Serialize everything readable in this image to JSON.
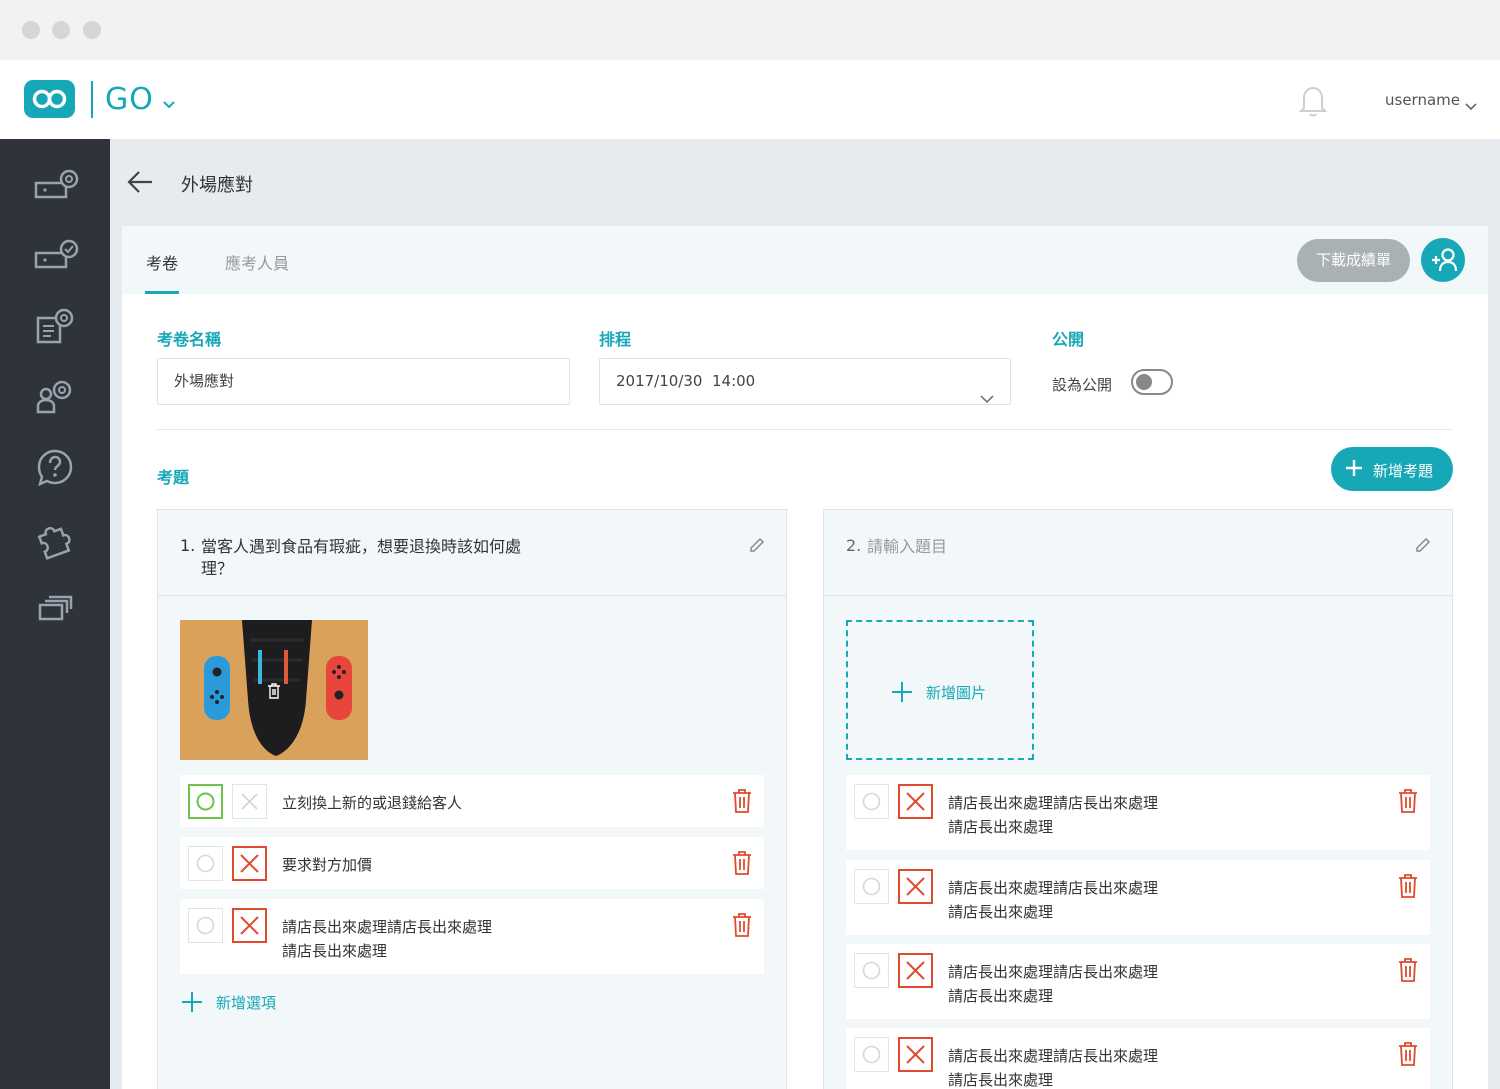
{
  "header": {
    "app_name": "GO",
    "username": "username"
  },
  "page": {
    "title": "外場應對"
  },
  "tabs": [
    {
      "label": "考卷"
    },
    {
      "label": "應考人員"
    }
  ],
  "actions": {
    "download_label": "下載成績單"
  },
  "form": {
    "name_label": "考卷名稱",
    "name_value": "外場應對",
    "schedule_label": "排程",
    "schedule_value": "2017/10/30  14:00",
    "public_label": "公開",
    "public_toggle_label": "設為公開",
    "public_on": false
  },
  "questions_section": {
    "label": "考題",
    "add_button_label": "新增考題"
  },
  "questions": [
    {
      "number": "1.",
      "text": "當客人遇到食品有瑕疵，想要退換時該如何處理？",
      "options": [
        {
          "text": "立刻換上新的或退錢給客人",
          "correct": true
        },
        {
          "text": "要求對方加價",
          "correct": false
        },
        {
          "text": "請店長出來處理請店長出來處理請店長出來處理",
          "correct": false
        }
      ],
      "add_option_label": "新增選項"
    },
    {
      "number": "2.",
      "text": "請輸入題目",
      "add_image_label": "新增圖片",
      "options": [
        {
          "text": "請店長出來處理請店長出來處理請店長出來處理",
          "correct": false
        },
        {
          "text": "請店長出來處理請店長出來處理請店長出來處理",
          "correct": false
        },
        {
          "text": "請店長出來處理請店長出來處理請店長出來處理",
          "correct": false
        },
        {
          "text": "請店長出來處理請店長出來處理請店長出來處理",
          "correct": false
        }
      ]
    }
  ],
  "colors": {
    "accent": "#17a8b8",
    "sidebar": "#2f333b",
    "correct": "#6cc24a",
    "wrong": "#e04b2e"
  }
}
